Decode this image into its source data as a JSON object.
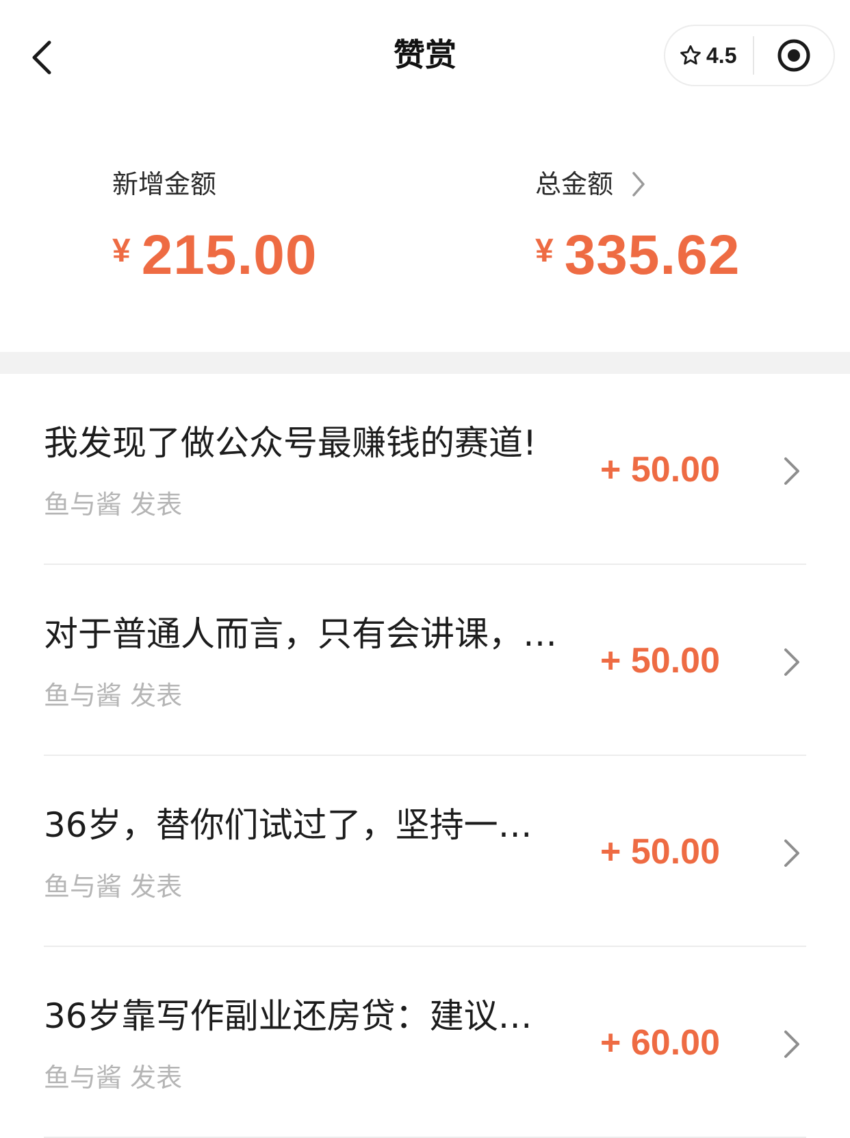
{
  "header": {
    "title": "赞赏",
    "rating": "4.5"
  },
  "summary": {
    "new_label": "新增金额",
    "new_currency": "¥",
    "new_amount": "215.00",
    "total_label": "总金额",
    "total_currency": "¥",
    "total_amount": "335.62"
  },
  "articles": [
    {
      "title": "我发现了做公众号最赚钱的赛道!",
      "meta": "鱼与酱 发表",
      "amount": "+ 50.00"
    },
    {
      "title": "对于普通人而言，只有会讲课，…",
      "meta": "鱼与酱 发表",
      "amount": "+ 50.00"
    },
    {
      "title": "36岁，替你们试过了，坚持一…",
      "meta": "鱼与酱 发表",
      "amount": "+ 50.00"
    },
    {
      "title": "36岁靠写作副业还房贷：建议…",
      "meta": "鱼与酱 发表",
      "amount": "+ 60.00"
    }
  ],
  "colors": {
    "accent": "#ee6b43",
    "muted_text": "#b5b5b5",
    "divider": "#ececec",
    "band": "#f2f2f2"
  },
  "icons": [
    "back-arrow-icon",
    "star-icon",
    "record-icon",
    "chevron-right-icon"
  ]
}
